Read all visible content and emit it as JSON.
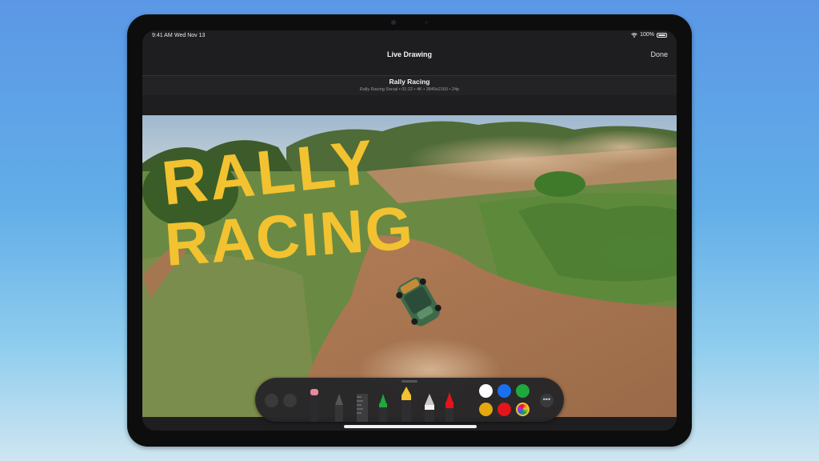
{
  "status": {
    "time": "9:41 AM",
    "date": "Wed Nov 13",
    "battery": "100%"
  },
  "nav": {
    "title": "Live Drawing",
    "done_label": "Done"
  },
  "video": {
    "title": "Rally Racing",
    "meta": "Rally Racing Social • 01:22 • 4K • 3840x2160 • 24p",
    "overlay_text_line1": "RALLY",
    "overlay_text_line2": "RACING"
  },
  "toolbar": {
    "buttons": [
      "undo",
      "redo"
    ],
    "tools": [
      "eraser-tool",
      "pencil-tool",
      "ruler-tool",
      "green-marker-tool",
      "yellow-marker-tool",
      "fountain-pen-tool",
      "red-crayon-tool"
    ],
    "colors": [
      "#ffffff",
      "#1a6ef0",
      "#1fa83c",
      "#e2a80e",
      "#e3141b",
      "multicolor"
    ],
    "more_icon": "more-icon"
  }
}
